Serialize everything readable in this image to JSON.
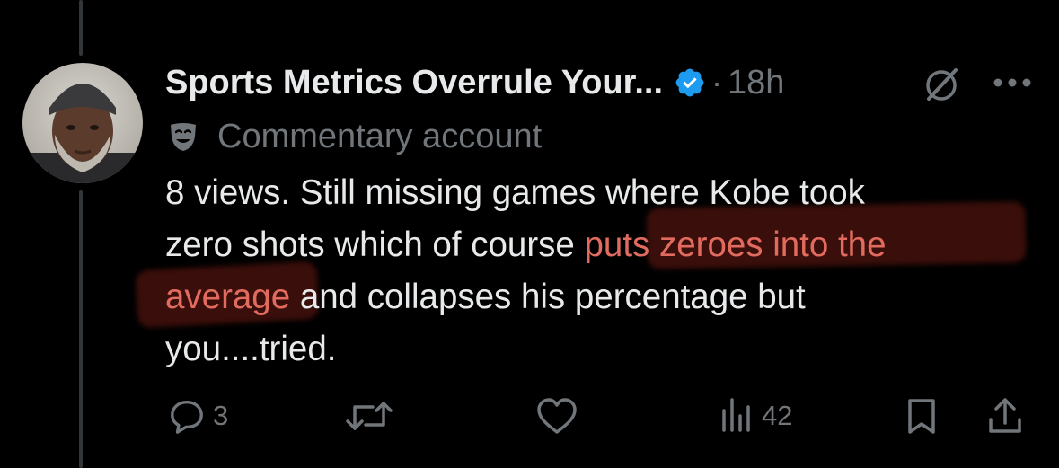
{
  "post": {
    "display_name": "Sports Metrics Overrule Your...",
    "separator": "·",
    "timestamp": "18h",
    "label": "Commentary account",
    "text_lines": [
      {
        "before": "8 views.  Still missing games where Kobe took",
        "highlight": "",
        "after": ""
      },
      {
        "before": "zero shots which of course ",
        "highlight": "puts zeroes into the",
        "after": ""
      },
      {
        "before": "",
        "highlight": "average",
        "after": " and collapses his percentage but"
      },
      {
        "before": "you....tried.",
        "highlight": "",
        "after": ""
      }
    ]
  },
  "actions": {
    "reply_count": "3",
    "repost_count": "",
    "like_count": "",
    "views_count": "42"
  },
  "icons": {
    "verified": "verified-badge-icon",
    "label": "theater-masks-icon",
    "grok": "grok-icon",
    "more": "more-dots-icon",
    "reply": "reply-icon",
    "repost": "repost-icon",
    "like": "heart-icon",
    "views": "views-icon",
    "bookmark": "bookmark-icon",
    "share": "share-icon"
  },
  "colors": {
    "background": "#000000",
    "text": "#e7e9ea",
    "secondary": "#71767b",
    "verified": "#1d9bf0",
    "highlight_text": "#e26b5f"
  }
}
